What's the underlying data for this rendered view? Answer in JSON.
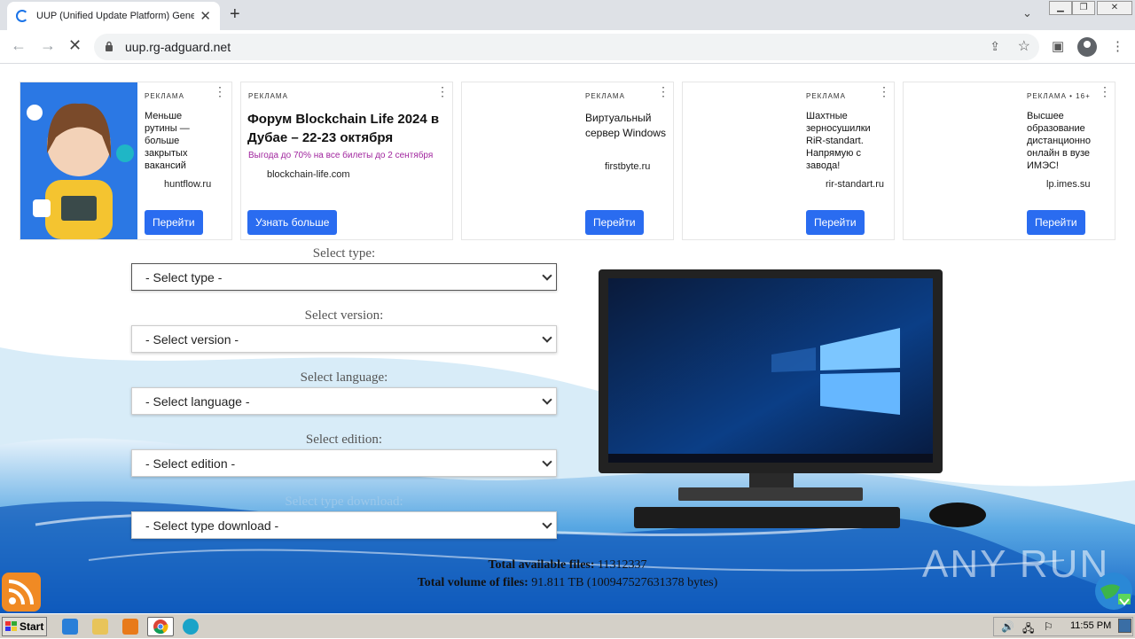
{
  "browser": {
    "tab_title": "UUP (Unified Update Platform) Gene",
    "url": "uup.rg-adguard.net"
  },
  "ads": [
    {
      "label": "РЕКЛАМА",
      "headline": "Меньше рутины — больше закрытых вакансий",
      "domain": "huntflow.ru",
      "button": "Перейти"
    },
    {
      "label": "РЕКЛАМА",
      "headline": "Форум Blockchain Life 2024 в Дубае – 22-23 октября",
      "subtext": "Выгода до 70% на все билеты до 2 сентября",
      "domain": "blockchain-life.com",
      "button": "Узнать больше"
    },
    {
      "label": "РЕКЛАМА",
      "headline": "Виртуальный сервер Windows",
      "domain": "firstbyte.ru",
      "button": "Перейти"
    },
    {
      "label": "РЕКЛАМА",
      "headline": "Шахтные зерносушилки RiR-standart. Напрямую с завода!",
      "domain": "rir-standart.ru",
      "button": "Перейти"
    },
    {
      "label": "РЕКЛАМА • 16+",
      "headline": "Высшее образование дистанционно онлайн в вузе ИМЭС!",
      "domain": "lp.imes.su",
      "button": "Перейти"
    }
  ],
  "form": {
    "type_label": "Select type:",
    "type_value": "- Select type -",
    "version_label": "Select version:",
    "version_value": "- Select version -",
    "language_label": "Select language:",
    "language_value": "- Select language -",
    "edition_label": "Select edition:",
    "edition_value": "- Select edition -",
    "download_label": "Select type download:",
    "download_value": "- Select type download -"
  },
  "stats": {
    "files_label": "Total available files:",
    "files_value": "11312337",
    "volume_label": "Total volume of files:",
    "volume_value": "91.811 TB (100947527631378 bytes)"
  },
  "watermark": "ANY RUN",
  "taskbar": {
    "start": "Start",
    "clock": "11:55 PM"
  }
}
